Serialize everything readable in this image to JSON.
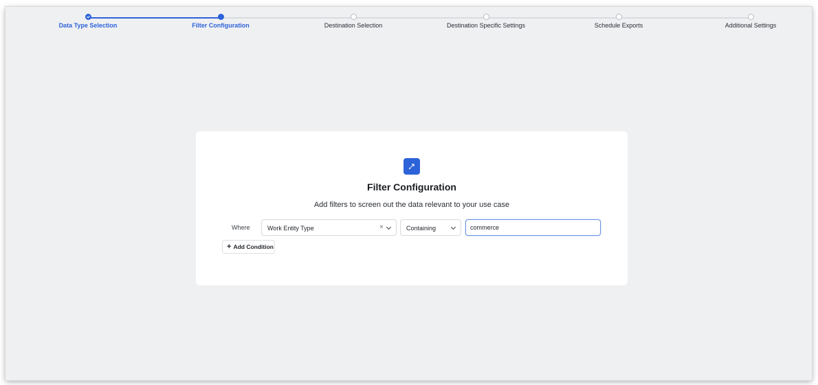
{
  "stepper": {
    "steps": [
      {
        "label": "Data Type Selection",
        "state": "done"
      },
      {
        "label": "Filter Configuration",
        "state": "active"
      },
      {
        "label": "Destination Selection",
        "state": "pending"
      },
      {
        "label": "Destination Specific Settings",
        "state": "pending"
      },
      {
        "label": "Schedule Exports",
        "state": "pending"
      },
      {
        "label": "Additional Settings",
        "state": "pending"
      }
    ]
  },
  "card": {
    "icon": "filter-swap-icon",
    "title": "Filter Configuration",
    "subtitle": "Add filters to screen out the data relevant to your use case",
    "condition": {
      "where_label": "Where",
      "field_value": "Work Entity Type",
      "clear_symbol": "×",
      "operator_value": "Containing",
      "text_value": "commerce"
    },
    "add_condition_plus": "+",
    "add_condition_label": "Add Condition"
  },
  "colors": {
    "accent": "#2d63d8",
    "background": "#eff0f2",
    "card": "#ffffff"
  }
}
